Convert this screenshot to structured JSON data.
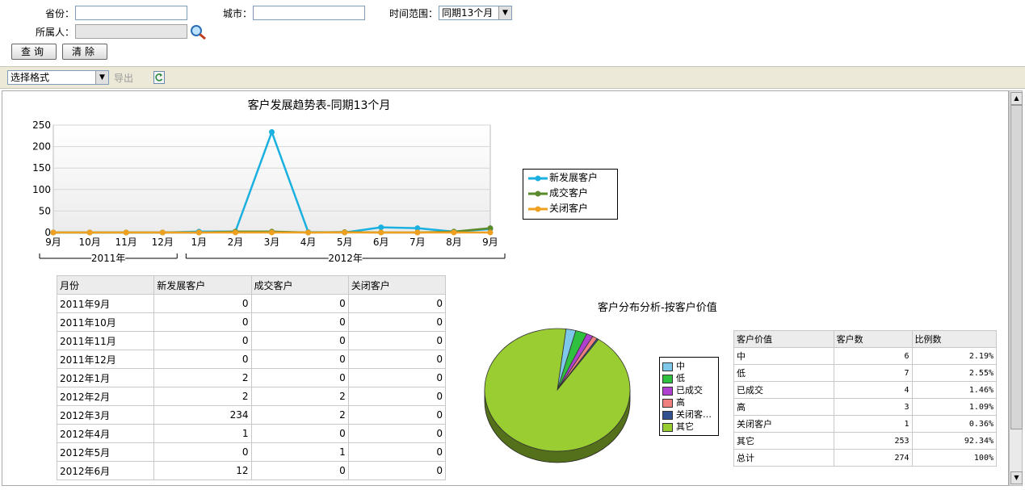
{
  "filters": {
    "province_label": "省份：",
    "province_value": "",
    "city_label": "城市：",
    "city_value": "",
    "time_range_label": "时间范围：",
    "time_range_value": "同期13个月",
    "owner_label": "所属人：",
    "owner_value": "",
    "query_button": "查询",
    "clear_button": "清除"
  },
  "toolbar": {
    "format_select": "选择格式",
    "export_label": "导出"
  },
  "line_chart": {
    "title": "客户发展趋势表-同期13个月",
    "legend": [
      "新发展客户",
      "成交客户",
      "关闭客户"
    ],
    "year_groups": [
      "2011年",
      "2012年"
    ]
  },
  "pie_chart": {
    "title": "客户分布分析-按客户价值",
    "legend": [
      "中",
      "低",
      "已成交",
      "高",
      "关闭客…",
      "其它"
    ]
  },
  "month_table": {
    "headers": [
      "月份",
      "新发展客户",
      "成交客户",
      "关闭客户"
    ],
    "rows": [
      [
        "2011年9月",
        "0",
        "0",
        "0"
      ],
      [
        "2011年10月",
        "0",
        "0",
        "0"
      ],
      [
        "2011年11月",
        "0",
        "0",
        "0"
      ],
      [
        "2011年12月",
        "0",
        "0",
        "0"
      ],
      [
        "2012年1月",
        "2",
        "0",
        "0"
      ],
      [
        "2012年2月",
        "2",
        "2",
        "0"
      ],
      [
        "2012年3月",
        "234",
        "2",
        "0"
      ],
      [
        "2012年4月",
        "1",
        "0",
        "0"
      ],
      [
        "2012年5月",
        "0",
        "1",
        "0"
      ],
      [
        "2012年6月",
        "12",
        "0",
        "0"
      ]
    ]
  },
  "value_table": {
    "headers": [
      "客户价值",
      "客户数",
      "比例数"
    ],
    "rows": [
      [
        "中",
        "6",
        "2.19%"
      ],
      [
        "低",
        "7",
        "2.55%"
      ],
      [
        "已成交",
        "4",
        "1.46%"
      ],
      [
        "高",
        "3",
        "1.09%"
      ],
      [
        "关闭客户",
        "1",
        "0.36%"
      ],
      [
        "其它",
        "253",
        "92.34%"
      ],
      [
        "总计",
        "274",
        "100%"
      ]
    ]
  },
  "chart_data": [
    {
      "type": "line",
      "title": "客户发展趋势表-同期13个月",
      "categories": [
        "9月",
        "10月",
        "11月",
        "12月",
        "1月",
        "2月",
        "3月",
        "4月",
        "5月",
        "6月",
        "7月",
        "8月",
        "9月"
      ],
      "series": [
        {
          "name": "新发展客户",
          "color": "#1ab0e0",
          "values": [
            0,
            0,
            0,
            0,
            2,
            2,
            234,
            1,
            0,
            12,
            10,
            2,
            8
          ]
        },
        {
          "name": "成交客户",
          "color": "#5a8a2a",
          "values": [
            0,
            0,
            0,
            0,
            0,
            2,
            2,
            0,
            1,
            0,
            0,
            2,
            10
          ]
        },
        {
          "name": "关闭客户",
          "color": "#f0a020",
          "values": [
            0,
            0,
            0,
            0,
            0,
            0,
            0,
            0,
            0,
            0,
            0,
            0,
            0
          ]
        }
      ],
      "ylim": [
        0,
        250
      ],
      "yticks": [
        0,
        50,
        100,
        150,
        200,
        250
      ],
      "xgroups": [
        {
          "label": "2011年",
          "from": 0,
          "to": 3
        },
        {
          "label": "2012年",
          "from": 4,
          "to": 12
        }
      ],
      "grid": true,
      "legend_position": "right"
    },
    {
      "type": "pie",
      "title": "客户分布分析-按客户价值",
      "slices": [
        {
          "label": "中",
          "value": 6,
          "color": "#7ec8ea"
        },
        {
          "label": "低",
          "value": 7,
          "color": "#30c040"
        },
        {
          "label": "已成交",
          "value": 4,
          "color": "#b040d0"
        },
        {
          "label": "高",
          "value": 3,
          "color": "#f08080"
        },
        {
          "label": "关闭客…",
          "value": 1,
          "color": "#305090"
        },
        {
          "label": "其它",
          "value": 253,
          "color": "#9acd32"
        }
      ],
      "legend_position": "right"
    }
  ]
}
